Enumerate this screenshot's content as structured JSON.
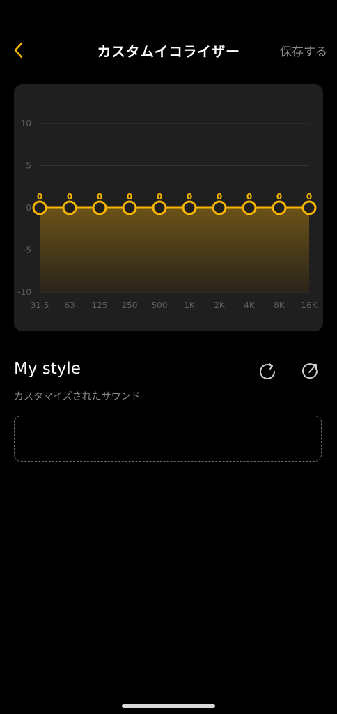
{
  "header": {
    "title": "カスタムイコライザー",
    "save_label": "保存する",
    "back_icon": "chevron-left-icon"
  },
  "colors": {
    "accent": "#f7b500",
    "card_bg": "#1f1f1f",
    "grid": "#333333",
    "muted_text": "#8a8a8a"
  },
  "chart_data": {
    "type": "line",
    "categories": [
      "31.5",
      "63",
      "125",
      "250",
      "500",
      "1K",
      "2K",
      "4K",
      "8K",
      "16K"
    ],
    "series": [
      {
        "values": [
          0,
          0,
          0,
          0,
          0,
          0,
          0,
          0,
          0,
          0
        ]
      }
    ],
    "y_ticks": [
      "10",
      "5",
      "0",
      "-5",
      "-10"
    ],
    "ylim": [
      -10,
      10
    ],
    "grid": true
  },
  "preset": {
    "name": "My style",
    "subtitle": "カスタマイズされたサウンド",
    "reset_icon": "reset-icon",
    "share_icon": "share-icon"
  }
}
